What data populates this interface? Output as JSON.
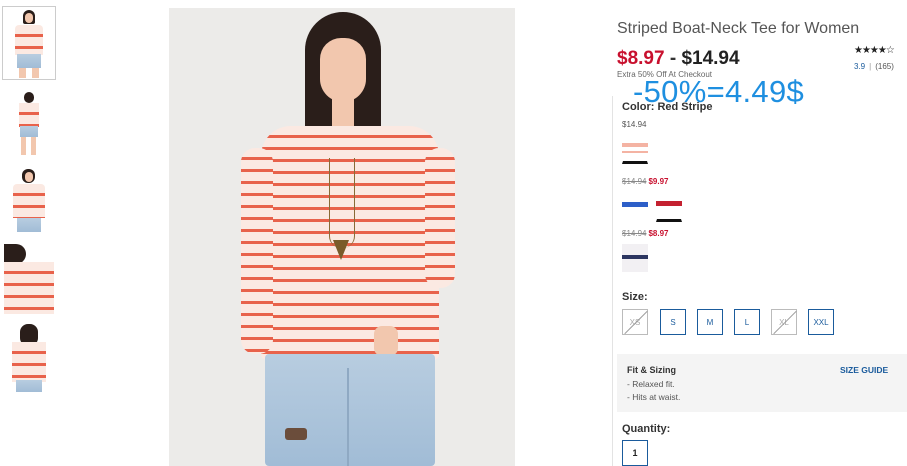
{
  "product": {
    "title": "Striped Boat-Neck Tee for Women",
    "price_low": "$8.97",
    "price_sep": "-",
    "price_high": "$14.94",
    "promo": "Extra 50% Off At Checkout",
    "stars_glyphs": "★★★★☆",
    "rating": "3.9",
    "reviews": "(165)"
  },
  "annotation": "-50%=4.49$",
  "colors": {
    "label": "Color: Red Stripe",
    "groups": [
      {
        "price": "$14.94",
        "original": "",
        "sale": ""
      },
      {
        "price": "",
        "original": "$14.94",
        "sale": "$9.97"
      },
      {
        "price": "",
        "original": "$14.94",
        "sale": "$8.97"
      }
    ],
    "swatches": [
      {
        "name": "red-stripe-swatch",
        "color": "#f4b3a3",
        "selected": true
      },
      {
        "name": "blue-stripe-swatch",
        "color": "#2d5fc8",
        "selected": false
      },
      {
        "name": "red-solid-swatch",
        "color": "#c42130",
        "selected": true
      },
      {
        "name": "lavender-swatch",
        "color": "#f2f0f3",
        "selected": false
      }
    ]
  },
  "sizes": {
    "label": "Size:",
    "options": [
      {
        "label": "XS",
        "available": false
      },
      {
        "label": "S",
        "available": true
      },
      {
        "label": "M",
        "available": true
      },
      {
        "label": "L",
        "available": true
      },
      {
        "label": "XL",
        "available": false
      },
      {
        "label": "XXL",
        "available": true
      }
    ]
  },
  "fit": {
    "title": "Fit & Sizing",
    "lines": [
      "- Relaxed fit.",
      "- Hits at waist."
    ],
    "size_guide": "SIZE GUIDE"
  },
  "quantity": {
    "label": "Quantity:",
    "value": "1"
  },
  "theme": {
    "accent": "#1a5b9c",
    "sale_red": "#c8102e",
    "annotation_blue": "#1e8fe0"
  }
}
